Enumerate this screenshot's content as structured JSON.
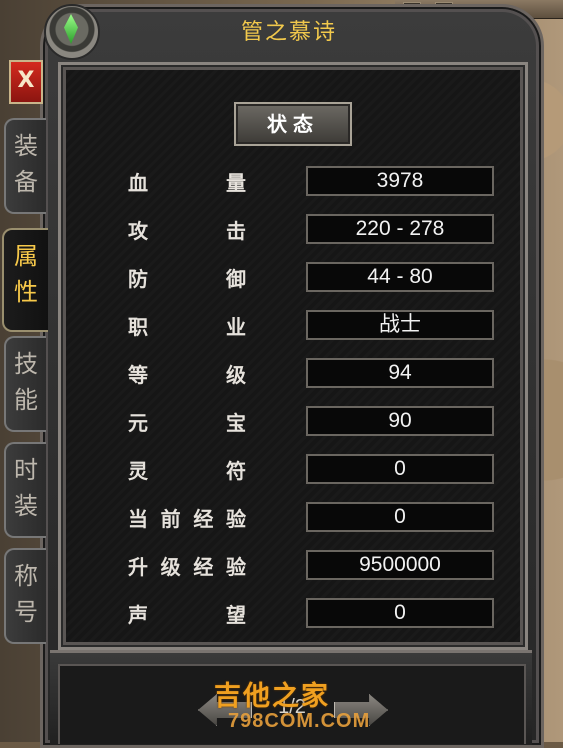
{
  "window": {
    "title": "管之慕诗"
  },
  "close_label": "X",
  "tabs": [
    {
      "label": "装备",
      "active": false
    },
    {
      "label": "属性",
      "active": true
    },
    {
      "label": "技能",
      "active": false
    },
    {
      "label": "时装",
      "active": false
    },
    {
      "label": "称号",
      "active": false
    }
  ],
  "status_button": "状态",
  "stats": [
    {
      "label": "血量",
      "value": "3978"
    },
    {
      "label": "攻击",
      "value": "220 - 278"
    },
    {
      "label": "防御",
      "value": "44 - 80"
    },
    {
      "label": "职业",
      "value": "战士"
    },
    {
      "label": "等级",
      "value": "94"
    },
    {
      "label": "元宝",
      "value": "90"
    },
    {
      "label": "灵符",
      "value": "0"
    },
    {
      "label": "当前经验",
      "value": "0"
    },
    {
      "label": "升级经验",
      "value": "9500000"
    },
    {
      "label": "声望",
      "value": "0"
    }
  ],
  "pager": {
    "text": "1/2"
  },
  "watermark": {
    "name": "吉他之家",
    "site": "798COM.COM"
  },
  "colors": {
    "title": "#f2c94c",
    "active_tab": "#f7c94a",
    "close": "#d42a1e"
  },
  "icons": [
    "gem-icon",
    "left-arrow-icon",
    "right-arrow-icon"
  ]
}
